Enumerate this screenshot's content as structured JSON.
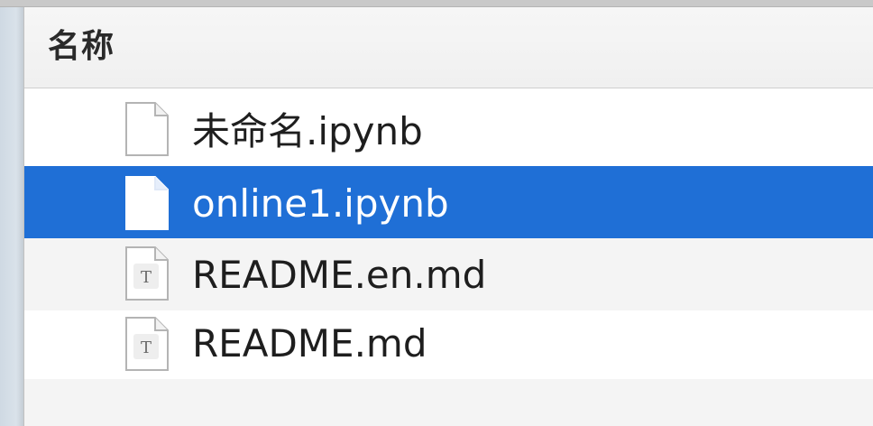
{
  "header": {
    "column_label": "名称"
  },
  "files": [
    {
      "name": "未命名.ipynb",
      "icon": "blank-document-icon",
      "selected": false
    },
    {
      "name": "online1.ipynb",
      "icon": "blank-document-icon",
      "selected": true
    },
    {
      "name": "README.en.md",
      "icon": "text-document-icon",
      "selected": false
    },
    {
      "name": "README.md",
      "icon": "text-document-icon",
      "selected": false
    }
  ],
  "colors": {
    "selection": "#1f6fd6",
    "selected_text": "#ffffff",
    "text": "#1e1e1e",
    "stripe": "#f4f4f4"
  },
  "icons": {
    "text_glyph": "T"
  }
}
